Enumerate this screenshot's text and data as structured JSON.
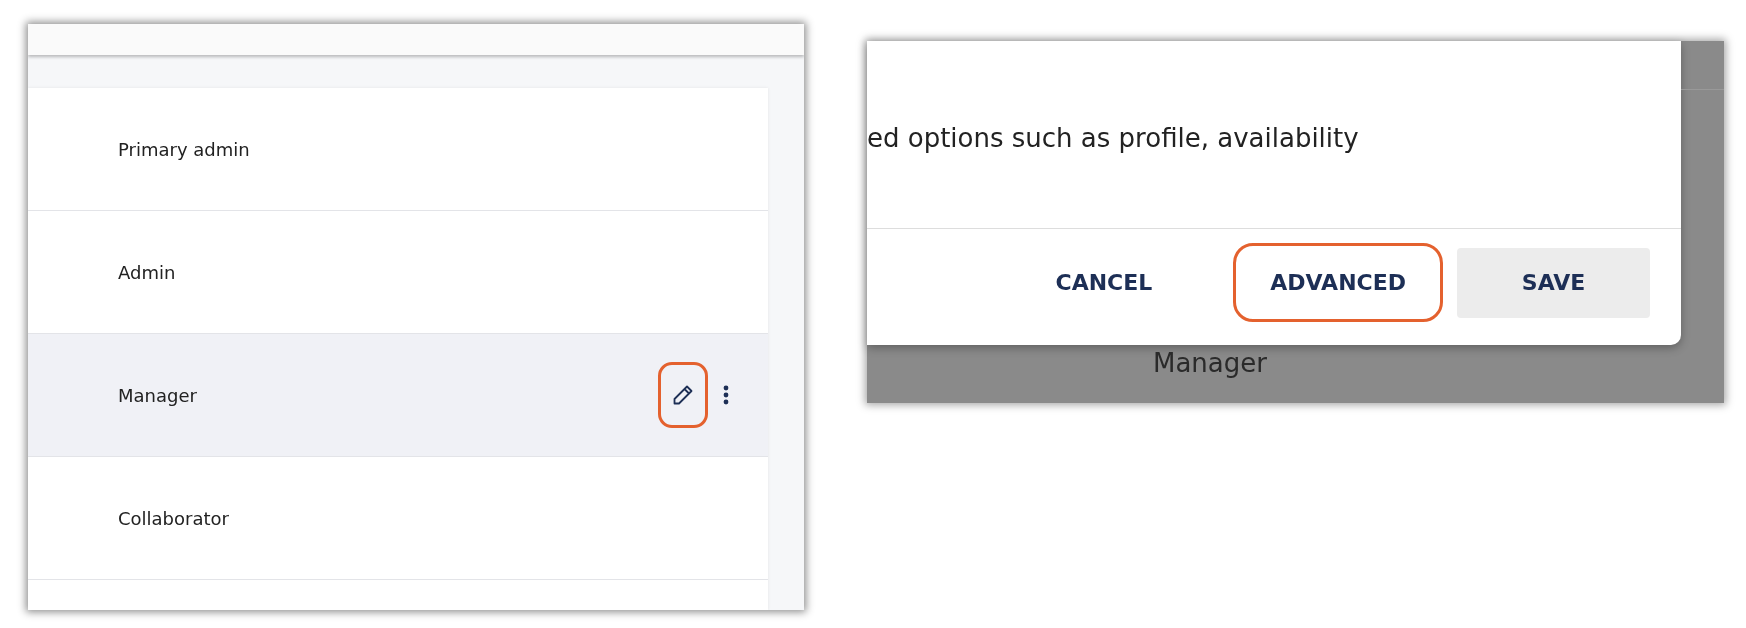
{
  "roles_panel": {
    "rows": [
      {
        "label": "Primary admin",
        "selected": false
      },
      {
        "label": "Admin",
        "selected": false
      },
      {
        "label": "Manager",
        "selected": true
      },
      {
        "label": "Collaborator",
        "selected": false
      }
    ],
    "edit_highlighted": true
  },
  "dialog": {
    "text": "ed options such as profile, availability",
    "buttons": [
      {
        "label": "CANCEL",
        "kind": "text",
        "highlighted": false
      },
      {
        "label": "ADVANCED",
        "kind": "text",
        "highlighted": true
      },
      {
        "label": "SAVE",
        "kind": "filled",
        "highlighted": false
      }
    ],
    "background_text": "Manager"
  }
}
